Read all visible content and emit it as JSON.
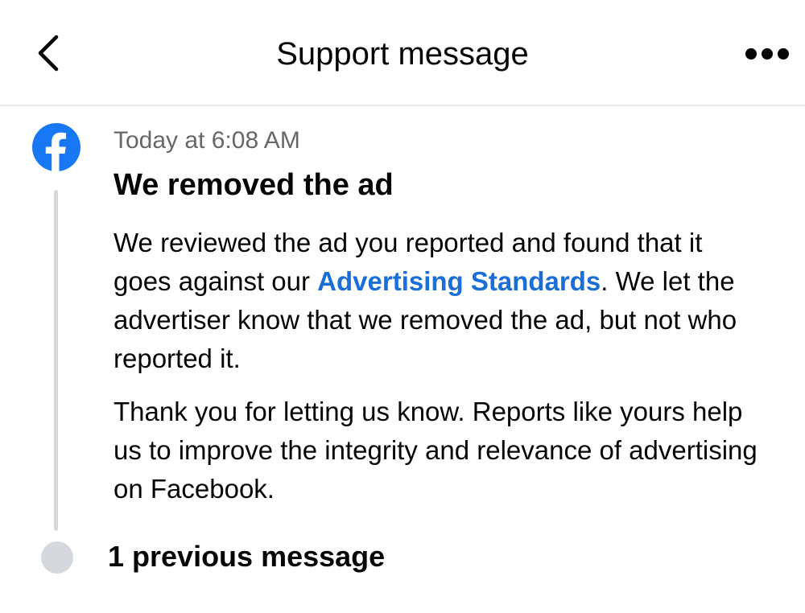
{
  "header": {
    "title": "Support message",
    "back_icon": "chevron-left-icon",
    "more_icon": "more-dots-icon"
  },
  "message": {
    "sender_icon": "facebook-logo-icon",
    "timestamp": "Today at 6:08 AM",
    "title": "We removed the ad",
    "paragraph1_before_link": "We reviewed the ad you reported and found that it goes against our ",
    "paragraph1_link": "Advertising Standards",
    "paragraph1_after_link": ". We let the advertiser know that we removed the ad, but not who reported it.",
    "paragraph2": "Thank you for letting us know. Reports like yours help us to improve the integrity and relevance of advertising on Facebook."
  },
  "previous": {
    "label": "1 previous message"
  },
  "colors": {
    "link": "#1a6ed8",
    "facebook_blue": "#1877f2",
    "timeline": "#d5d8dc",
    "secondary_text": "#65676b"
  }
}
